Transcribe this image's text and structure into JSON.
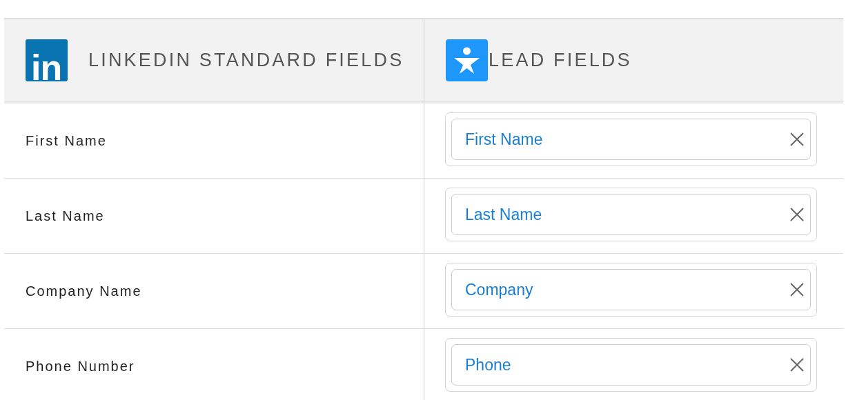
{
  "header": {
    "columns": [
      {
        "kind": "linkedin",
        "logo_text": "in",
        "title": "LINKEDIN STANDARD FIELDS"
      },
      {
        "kind": "lead",
        "title": "LEAD FIELDS"
      }
    ]
  },
  "rows": [
    {
      "label": "First Name",
      "value": "First Name"
    },
    {
      "label": "Last Name",
      "value": "Last Name"
    },
    {
      "label": "Company Name",
      "value": "Company"
    },
    {
      "label": "Phone Number",
      "value": "Phone"
    }
  ]
}
